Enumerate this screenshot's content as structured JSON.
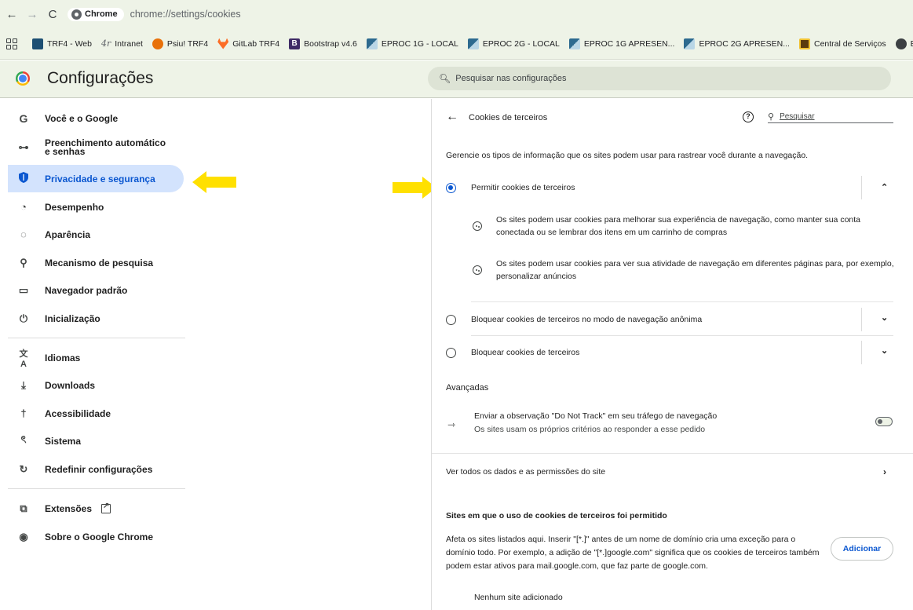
{
  "browser": {
    "chip_label": "Chrome",
    "url": "chrome://settings/cookies",
    "bookmarks": [
      {
        "label": "TRF4 - Web",
        "icon": "trf4-icon"
      },
      {
        "label": "Intranet",
        "icon": "intranet-logo"
      },
      {
        "label": "Psiu! TRF4",
        "icon": "psiu-icon"
      },
      {
        "label": "GitLab TRF4",
        "icon": "gitlab-icon"
      },
      {
        "label": "Bootstrap v4.6",
        "icon": "bootstrap-icon"
      },
      {
        "label": "EPROC 1G - LOCAL",
        "icon": "eproc-icon"
      },
      {
        "label": "EPROC 2G - LOCAL",
        "icon": "eproc-icon"
      },
      {
        "label": "EPROC 1G APRESEN...",
        "icon": "eproc-icon"
      },
      {
        "label": "EPROC 2G APRESEN...",
        "icon": "eproc-icon"
      },
      {
        "label": "Central de Serviços",
        "icon": "central-servicos-icon"
      },
      {
        "label": "E/",
        "icon": "chrome-icon"
      }
    ]
  },
  "header": {
    "title": "Configurações",
    "search_placeholder": "Pesquisar nas configurações"
  },
  "sidebar": {
    "items": [
      {
        "label": "Você e o Google",
        "icon": "google-g-icon"
      },
      {
        "label": "Preenchimento automático e senhas",
        "icon": "key-icon"
      },
      {
        "label": "Privacidade e segurança",
        "icon": "shield-icon",
        "active": true
      },
      {
        "label": "Desempenho",
        "icon": "speedometer-icon"
      },
      {
        "label": "Aparência",
        "icon": "palette-icon"
      },
      {
        "label": "Mecanismo de pesquisa",
        "icon": "search-icon"
      },
      {
        "label": "Navegador padrão",
        "icon": "browser-window-icon"
      },
      {
        "label": "Inicialização",
        "icon": "power-icon"
      },
      {
        "label": "Idiomas",
        "icon": "translate-icon"
      },
      {
        "label": "Downloads",
        "icon": "download-icon"
      },
      {
        "label": "Acessibilidade",
        "icon": "accessibility-icon"
      },
      {
        "label": "Sistema",
        "icon": "wrench-icon"
      },
      {
        "label": "Redefinir configurações",
        "icon": "reset-icon"
      },
      {
        "label": "Extensões",
        "icon": "puzzle-icon"
      },
      {
        "label": "Sobre o Google Chrome",
        "icon": "chrome-icon"
      }
    ]
  },
  "page": {
    "title": "Cookies de terceiros",
    "search_placeholder": "Pesquisar",
    "description": "Gerencie os tipos de informação que os sites podem usar para rastrear você durante a navegação.",
    "options": [
      {
        "label": "Permitir cookies de terceiros",
        "selected": true,
        "expanded": true
      },
      {
        "label": "Bloquear cookies de terceiros no modo de navegação anônima",
        "selected": false,
        "expanded": false
      },
      {
        "label": "Bloquear cookies de terceiros",
        "selected": false,
        "expanded": false
      }
    ],
    "allow_details": [
      "Os sites podem usar cookies para melhorar sua experiência de navegação, como manter sua conta conectada ou se lembrar dos itens em um carrinho de compras",
      "Os sites podem usar cookies para ver sua atividade de navegação em diferentes páginas para, por exemplo, personalizar anúncios"
    ],
    "advanced_label": "Avançadas",
    "dnt_title": "Enviar a observação \"Do Not Track\" em seu tráfego de navegação",
    "dnt_subtitle": "Os sites usam os próprios critérios ao responder a esse pedido",
    "dnt_enabled": false,
    "site_data_link": "Ver todos os dados e as permissões do site",
    "allowed_title": "Sites em que o uso de cookies de terceiros foi permitido",
    "allowed_description": "Afeta os sites listados aqui. Inserir \"[*.]\" antes de um nome de domínio cria uma exceção para o domínio todo. Por exemplo, a adição de \"[*.]google.com\" significa que os cookies de terceiros também podem estar ativos para mail.google.com, que faz parte de google.com.",
    "add_button": "Adicionar",
    "empty_message": "Nenhum site adicionado"
  },
  "colors": {
    "accent": "#0b57d0",
    "active_bg": "#d3e3fd",
    "annotation_arrow": "#ffe000",
    "chrome_bg": "#eef3e7"
  }
}
